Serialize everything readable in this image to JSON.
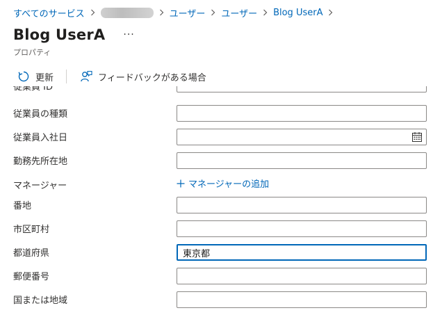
{
  "breadcrumb": {
    "items": [
      "すべてのサービス",
      "ユーザー",
      "ユーザー",
      "Blog UserA"
    ]
  },
  "header": {
    "title": "Blog UserA",
    "more": "···",
    "subtitle": "プロパティ"
  },
  "toolbar": {
    "refresh_label": "更新",
    "feedback_label": "フィードバックがある場合"
  },
  "form": {
    "employee_id_label": "従業員 ID",
    "employee_type_label": "従業員の種類",
    "hire_date_label": "従業員入社日",
    "office_location_label": "勤務先所在地",
    "manager_label": "マネージャー",
    "add_manager_label": "マネージャーの追加",
    "street_label": "番地",
    "city_label": "市区町村",
    "state_label": "都道府県",
    "state_value": "東京都",
    "postal_code_label": "郵便番号",
    "country_label": "国または地域"
  },
  "colors": {
    "link": "#0067b8",
    "focus_border": "#0067b8",
    "input_border": "#8a8886"
  }
}
